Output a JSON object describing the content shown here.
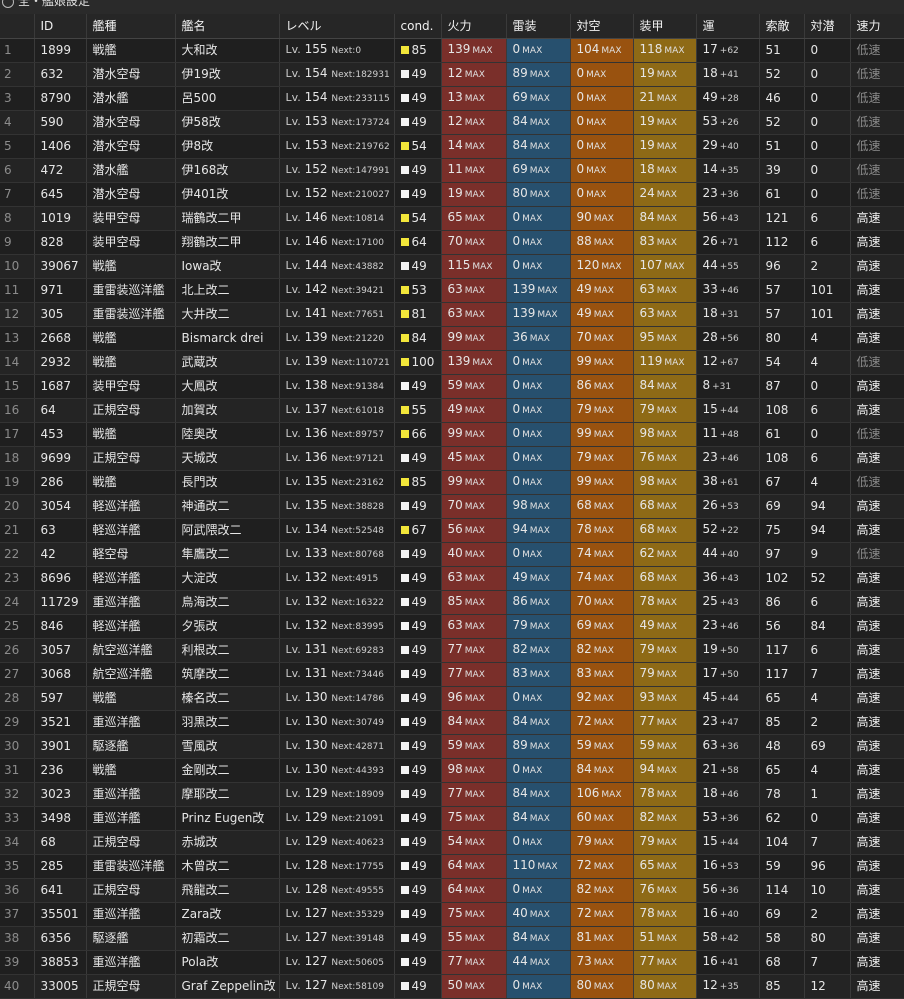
{
  "window": {
    "title": "全・艦娘設定"
  },
  "columns": [
    "",
    "ID",
    "艦種",
    "艦名",
    "レベル",
    "cond.",
    "火力",
    "雷装",
    "対空",
    "装甲",
    "運",
    "索敵",
    "対潜",
    "速力"
  ],
  "max_label": "MAX",
  "lv_prefix": "Lv.",
  "next_prefix": "Next:",
  "colors": {
    "fire": "#7a2f2a",
    "torpedo": "#27506e",
    "aa": "#99520f",
    "armor": "#8e6a16",
    "cond_sparkle": "#f2e63a",
    "cond_normal": "#f4f4f4"
  },
  "rows": [
    {
      "no": "1",
      "id": "1899",
      "type": "戦艦",
      "name": "大和改",
      "lv": "155",
      "next": "0",
      "cond": "85",
      "fire": "139",
      "torp": "0",
      "aa": "104",
      "armor": "118",
      "luck": "17",
      "luck_plus": "+62",
      "los": "51",
      "asw": "0",
      "speed": "低速"
    },
    {
      "no": "2",
      "id": "632",
      "type": "潜水空母",
      "name": "伊19改",
      "lv": "154",
      "next": "182931",
      "cond": "49",
      "fire": "12",
      "torp": "89",
      "aa": "0",
      "armor": "19",
      "luck": "18",
      "luck_plus": "+41",
      "los": "52",
      "asw": "0",
      "speed": "低速"
    },
    {
      "no": "3",
      "id": "8790",
      "type": "潜水艦",
      "name": "呂500",
      "lv": "154",
      "next": "233115",
      "cond": "49",
      "fire": "13",
      "torp": "69",
      "aa": "0",
      "armor": "21",
      "luck": "49",
      "luck_plus": "+28",
      "los": "46",
      "asw": "0",
      "speed": "低速"
    },
    {
      "no": "4",
      "id": "590",
      "type": "潜水空母",
      "name": "伊58改",
      "lv": "153",
      "next": "173724",
      "cond": "49",
      "fire": "12",
      "torp": "84",
      "aa": "0",
      "armor": "19",
      "luck": "53",
      "luck_plus": "+26",
      "los": "52",
      "asw": "0",
      "speed": "低速"
    },
    {
      "no": "5",
      "id": "1406",
      "type": "潜水空母",
      "name": "伊8改",
      "lv": "153",
      "next": "219762",
      "cond": "54",
      "fire": "14",
      "torp": "84",
      "aa": "0",
      "armor": "19",
      "luck": "29",
      "luck_plus": "+40",
      "los": "51",
      "asw": "0",
      "speed": "低速"
    },
    {
      "no": "6",
      "id": "472",
      "type": "潜水艦",
      "name": "伊168改",
      "lv": "152",
      "next": "147991",
      "cond": "49",
      "fire": "11",
      "torp": "69",
      "aa": "0",
      "armor": "18",
      "luck": "14",
      "luck_plus": "+35",
      "los": "39",
      "asw": "0",
      "speed": "低速"
    },
    {
      "no": "7",
      "id": "645",
      "type": "潜水空母",
      "name": "伊401改",
      "lv": "152",
      "next": "210027",
      "cond": "49",
      "fire": "19",
      "torp": "80",
      "aa": "0",
      "armor": "24",
      "luck": "23",
      "luck_plus": "+36",
      "los": "61",
      "asw": "0",
      "speed": "低速"
    },
    {
      "no": "8",
      "id": "1019",
      "type": "装甲空母",
      "name": "瑞鶴改二甲",
      "lv": "146",
      "next": "10814",
      "cond": "54",
      "fire": "65",
      "torp": "0",
      "aa": "90",
      "armor": "84",
      "luck": "56",
      "luck_plus": "+43",
      "los": "121",
      "asw": "6",
      "speed": "高速"
    },
    {
      "no": "9",
      "id": "828",
      "type": "装甲空母",
      "name": "翔鶴改二甲",
      "lv": "146",
      "next": "17100",
      "cond": "64",
      "fire": "70",
      "torp": "0",
      "aa": "88",
      "armor": "83",
      "luck": "26",
      "luck_plus": "+71",
      "los": "112",
      "asw": "6",
      "speed": "高速"
    },
    {
      "no": "10",
      "id": "39067",
      "type": "戦艦",
      "name": "Iowa改",
      "lv": "144",
      "next": "43882",
      "cond": "49",
      "fire": "115",
      "torp": "0",
      "aa": "120",
      "armor": "107",
      "luck": "44",
      "luck_plus": "+55",
      "los": "96",
      "asw": "2",
      "speed": "高速"
    },
    {
      "no": "11",
      "id": "971",
      "type": "重雷装巡洋艦",
      "name": "北上改二",
      "lv": "142",
      "next": "39421",
      "cond": "53",
      "fire": "63",
      "torp": "139",
      "aa": "49",
      "armor": "63",
      "luck": "33",
      "luck_plus": "+46",
      "los": "57",
      "asw": "101",
      "speed": "高速"
    },
    {
      "no": "12",
      "id": "305",
      "type": "重雷装巡洋艦",
      "name": "大井改二",
      "lv": "141",
      "next": "77651",
      "cond": "81",
      "fire": "63",
      "torp": "139",
      "aa": "49",
      "armor": "63",
      "luck": "18",
      "luck_plus": "+31",
      "los": "57",
      "asw": "101",
      "speed": "高速"
    },
    {
      "no": "13",
      "id": "2668",
      "type": "戦艦",
      "name": "Bismarck drei",
      "lv": "139",
      "next": "21220",
      "cond": "84",
      "fire": "99",
      "torp": "36",
      "aa": "70",
      "armor": "95",
      "luck": "28",
      "luck_plus": "+56",
      "los": "80",
      "asw": "4",
      "speed": "高速"
    },
    {
      "no": "14",
      "id": "2932",
      "type": "戦艦",
      "name": "武蔵改",
      "lv": "139",
      "next": "110721",
      "cond": "100",
      "fire": "139",
      "torp": "0",
      "aa": "99",
      "armor": "119",
      "luck": "12",
      "luck_plus": "+67",
      "los": "54",
      "asw": "4",
      "speed": "低速"
    },
    {
      "no": "15",
      "id": "1687",
      "type": "装甲空母",
      "name": "大鳳改",
      "lv": "138",
      "next": "91384",
      "cond": "49",
      "fire": "59",
      "torp": "0",
      "aa": "86",
      "armor": "84",
      "luck": "8",
      "luck_plus": "+31",
      "los": "87",
      "asw": "0",
      "speed": "高速"
    },
    {
      "no": "16",
      "id": "64",
      "type": "正規空母",
      "name": "加賀改",
      "lv": "137",
      "next": "61018",
      "cond": "55",
      "fire": "49",
      "torp": "0",
      "aa": "79",
      "armor": "79",
      "luck": "15",
      "luck_plus": "+44",
      "los": "108",
      "asw": "6",
      "speed": "高速"
    },
    {
      "no": "17",
      "id": "453",
      "type": "戦艦",
      "name": "陸奥改",
      "lv": "136",
      "next": "89757",
      "cond": "66",
      "fire": "99",
      "torp": "0",
      "aa": "99",
      "armor": "98",
      "luck": "11",
      "luck_plus": "+48",
      "los": "61",
      "asw": "0",
      "speed": "低速"
    },
    {
      "no": "18",
      "id": "9699",
      "type": "正規空母",
      "name": "天城改",
      "lv": "136",
      "next": "97121",
      "cond": "49",
      "fire": "45",
      "torp": "0",
      "aa": "79",
      "armor": "76",
      "luck": "23",
      "luck_plus": "+46",
      "los": "108",
      "asw": "6",
      "speed": "高速"
    },
    {
      "no": "19",
      "id": "286",
      "type": "戦艦",
      "name": "長門改",
      "lv": "135",
      "next": "23162",
      "cond": "85",
      "fire": "99",
      "torp": "0",
      "aa": "99",
      "armor": "98",
      "luck": "38",
      "luck_plus": "+61",
      "los": "67",
      "asw": "4",
      "speed": "低速"
    },
    {
      "no": "20",
      "id": "3054",
      "type": "軽巡洋艦",
      "name": "神通改二",
      "lv": "135",
      "next": "38828",
      "cond": "49",
      "fire": "70",
      "torp": "98",
      "aa": "68",
      "armor": "68",
      "luck": "26",
      "luck_plus": "+53",
      "los": "69",
      "asw": "94",
      "speed": "高速"
    },
    {
      "no": "21",
      "id": "63",
      "type": "軽巡洋艦",
      "name": "阿武隈改二",
      "lv": "134",
      "next": "52548",
      "cond": "67",
      "fire": "56",
      "torp": "94",
      "aa": "78",
      "armor": "68",
      "luck": "52",
      "luck_plus": "+22",
      "los": "75",
      "asw": "94",
      "speed": "高速"
    },
    {
      "no": "22",
      "id": "42",
      "type": "軽空母",
      "name": "隼鷹改二",
      "lv": "133",
      "next": "80768",
      "cond": "49",
      "fire": "40",
      "torp": "0",
      "aa": "74",
      "armor": "62",
      "luck": "44",
      "luck_plus": "+40",
      "los": "97",
      "asw": "9",
      "speed": "低速"
    },
    {
      "no": "23",
      "id": "8696",
      "type": "軽巡洋艦",
      "name": "大淀改",
      "lv": "132",
      "next": "4915",
      "cond": "49",
      "fire": "63",
      "torp": "49",
      "aa": "74",
      "armor": "68",
      "luck": "36",
      "luck_plus": "+43",
      "los": "102",
      "asw": "52",
      "speed": "高速"
    },
    {
      "no": "24",
      "id": "11729",
      "type": "重巡洋艦",
      "name": "鳥海改二",
      "lv": "132",
      "next": "16322",
      "cond": "49",
      "fire": "85",
      "torp": "86",
      "aa": "70",
      "armor": "78",
      "luck": "25",
      "luck_plus": "+43",
      "los": "86",
      "asw": "6",
      "speed": "高速"
    },
    {
      "no": "25",
      "id": "846",
      "type": "軽巡洋艦",
      "name": "夕張改",
      "lv": "132",
      "next": "83995",
      "cond": "49",
      "fire": "63",
      "torp": "79",
      "aa": "69",
      "armor": "49",
      "luck": "23",
      "luck_plus": "+46",
      "los": "56",
      "asw": "84",
      "speed": "高速"
    },
    {
      "no": "26",
      "id": "3057",
      "type": "航空巡洋艦",
      "name": "利根改二",
      "lv": "131",
      "next": "69283",
      "cond": "49",
      "fire": "77",
      "torp": "82",
      "aa": "82",
      "armor": "79",
      "luck": "19",
      "luck_plus": "+50",
      "los": "117",
      "asw": "6",
      "speed": "高速"
    },
    {
      "no": "27",
      "id": "3068",
      "type": "航空巡洋艦",
      "name": "筑摩改二",
      "lv": "131",
      "next": "73446",
      "cond": "49",
      "fire": "77",
      "torp": "83",
      "aa": "83",
      "armor": "79",
      "luck": "17",
      "luck_plus": "+50",
      "los": "117",
      "asw": "7",
      "speed": "高速"
    },
    {
      "no": "28",
      "id": "597",
      "type": "戦艦",
      "name": "榛名改二",
      "lv": "130",
      "next": "14786",
      "cond": "49",
      "fire": "96",
      "torp": "0",
      "aa": "92",
      "armor": "93",
      "luck": "45",
      "luck_plus": "+44",
      "los": "65",
      "asw": "4",
      "speed": "高速"
    },
    {
      "no": "29",
      "id": "3521",
      "type": "重巡洋艦",
      "name": "羽黒改二",
      "lv": "130",
      "next": "30749",
      "cond": "49",
      "fire": "84",
      "torp": "84",
      "aa": "72",
      "armor": "77",
      "luck": "23",
      "luck_plus": "+47",
      "los": "85",
      "asw": "2",
      "speed": "高速"
    },
    {
      "no": "30",
      "id": "3901",
      "type": "駆逐艦",
      "name": "雪風改",
      "lv": "130",
      "next": "42871",
      "cond": "49",
      "fire": "59",
      "torp": "89",
      "aa": "59",
      "armor": "59",
      "luck": "63",
      "luck_plus": "+36",
      "los": "48",
      "asw": "69",
      "speed": "高速"
    },
    {
      "no": "31",
      "id": "236",
      "type": "戦艦",
      "name": "金剛改二",
      "lv": "130",
      "next": "44393",
      "cond": "49",
      "fire": "98",
      "torp": "0",
      "aa": "84",
      "armor": "94",
      "luck": "21",
      "luck_plus": "+58",
      "los": "65",
      "asw": "4",
      "speed": "高速"
    },
    {
      "no": "32",
      "id": "3023",
      "type": "重巡洋艦",
      "name": "摩耶改二",
      "lv": "129",
      "next": "18909",
      "cond": "49",
      "fire": "77",
      "torp": "84",
      "aa": "106",
      "armor": "78",
      "luck": "18",
      "luck_plus": "+46",
      "los": "78",
      "asw": "1",
      "speed": "高速"
    },
    {
      "no": "33",
      "id": "3498",
      "type": "重巡洋艦",
      "name": "Prinz Eugen改",
      "lv": "129",
      "next": "21091",
      "cond": "49",
      "fire": "75",
      "torp": "84",
      "aa": "60",
      "armor": "82",
      "luck": "53",
      "luck_plus": "+36",
      "los": "62",
      "asw": "0",
      "speed": "高速"
    },
    {
      "no": "34",
      "id": "68",
      "type": "正規空母",
      "name": "赤城改",
      "lv": "129",
      "next": "40623",
      "cond": "49",
      "fire": "54",
      "torp": "0",
      "aa": "79",
      "armor": "79",
      "luck": "15",
      "luck_plus": "+44",
      "los": "104",
      "asw": "7",
      "speed": "高速"
    },
    {
      "no": "35",
      "id": "285",
      "type": "重雷装巡洋艦",
      "name": "木曾改二",
      "lv": "128",
      "next": "17755",
      "cond": "49",
      "fire": "64",
      "torp": "110",
      "aa": "72",
      "armor": "65",
      "luck": "16",
      "luck_plus": "+53",
      "los": "59",
      "asw": "96",
      "speed": "高速"
    },
    {
      "no": "36",
      "id": "641",
      "type": "正規空母",
      "name": "飛龍改二",
      "lv": "128",
      "next": "49555",
      "cond": "49",
      "fire": "64",
      "torp": "0",
      "aa": "82",
      "armor": "76",
      "luck": "56",
      "luck_plus": "+36",
      "los": "114",
      "asw": "10",
      "speed": "高速"
    },
    {
      "no": "37",
      "id": "35501",
      "type": "重巡洋艦",
      "name": "Zara改",
      "lv": "127",
      "next": "35329",
      "cond": "49",
      "fire": "75",
      "torp": "40",
      "aa": "72",
      "armor": "78",
      "luck": "16",
      "luck_plus": "+40",
      "los": "69",
      "asw": "2",
      "speed": "高速"
    },
    {
      "no": "38",
      "id": "6356",
      "type": "駆逐艦",
      "name": "初霜改二",
      "lv": "127",
      "next": "39148",
      "cond": "49",
      "fire": "55",
      "torp": "84",
      "aa": "81",
      "armor": "51",
      "luck": "58",
      "luck_plus": "+42",
      "los": "58",
      "asw": "80",
      "speed": "高速"
    },
    {
      "no": "39",
      "id": "38853",
      "type": "重巡洋艦",
      "name": "Pola改",
      "lv": "127",
      "next": "50605",
      "cond": "49",
      "fire": "77",
      "torp": "44",
      "aa": "73",
      "armor": "77",
      "luck": "16",
      "luck_plus": "+41",
      "los": "68",
      "asw": "7",
      "speed": "高速"
    },
    {
      "no": "40",
      "id": "33005",
      "type": "正規空母",
      "name": "Graf Zeppelin改",
      "lv": "127",
      "next": "58109",
      "cond": "49",
      "fire": "50",
      "torp": "0",
      "aa": "80",
      "armor": "80",
      "luck": "12",
      "luck_plus": "+35",
      "los": "85",
      "asw": "12",
      "speed": "高速"
    }
  ]
}
